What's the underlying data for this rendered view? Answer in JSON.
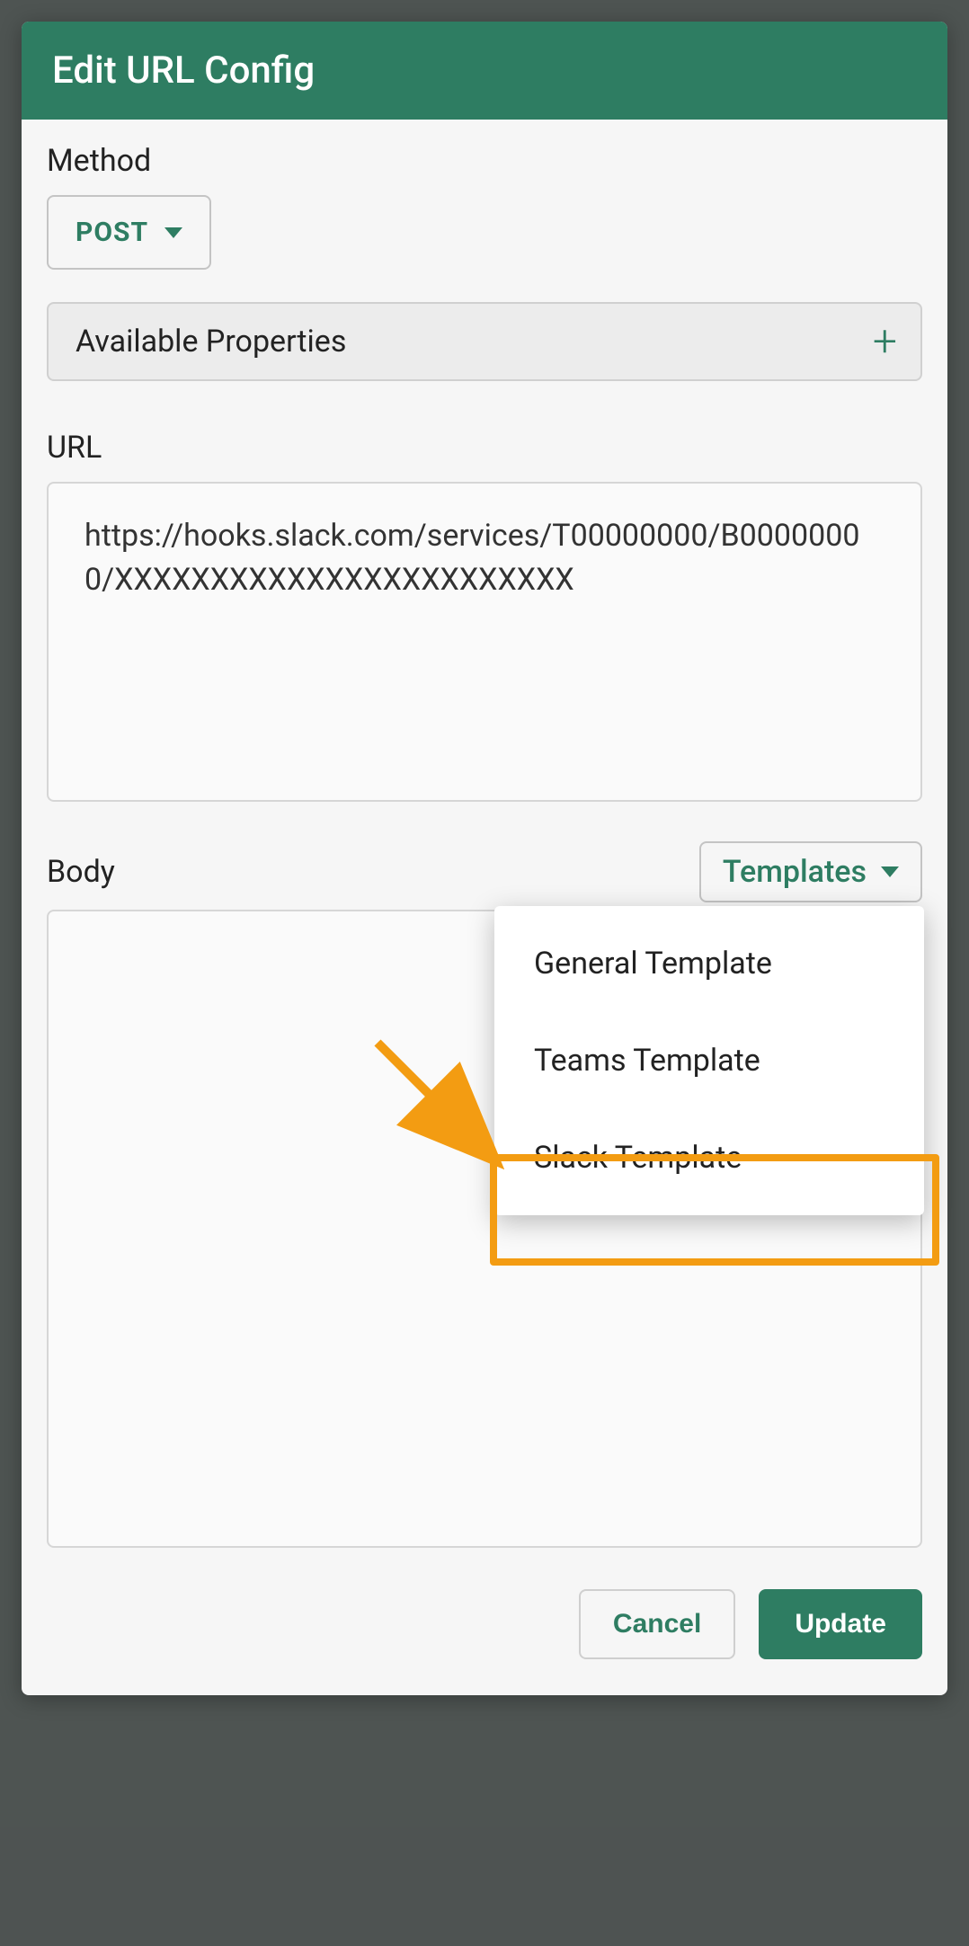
{
  "modal": {
    "title": "Edit URL Config"
  },
  "method": {
    "label": "Method",
    "value": "POST"
  },
  "properties_panel": {
    "label": "Available Properties"
  },
  "url": {
    "label": "URL",
    "value": "https://hooks.slack.com/services/T00000000/B00000000/XXXXXXXXXXXXXXXXXXXXXXXX"
  },
  "body": {
    "label": "Body",
    "templates_label": "Templates",
    "value": ""
  },
  "templates_menu": {
    "items": [
      {
        "label": "General Template"
      },
      {
        "label": "Teams Template"
      },
      {
        "label": "Slack Template"
      }
    ]
  },
  "footer": {
    "cancel": "Cancel",
    "update": "Update"
  },
  "annotation": {
    "highlight_target": "Slack Template"
  }
}
